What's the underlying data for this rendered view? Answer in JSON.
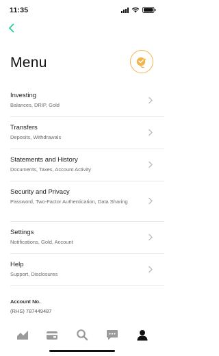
{
  "status_bar": {
    "time": "11:35"
  },
  "header": {
    "title": "Menu"
  },
  "menu": [
    {
      "label": "Investing",
      "sub": "Balances, DRIP, Gold"
    },
    {
      "label": "Transfers",
      "sub": "Deposits, Withdrawals"
    },
    {
      "label": "Statements and History",
      "sub": "Documents, Taxes, Account Activity"
    },
    {
      "label": "Security and Privacy",
      "sub": "Password, Two-Factor Authentication, Data Sharing"
    },
    {
      "label": "Settings",
      "sub": "Notifications, Gold, Account"
    },
    {
      "label": "Help",
      "sub": "Support, Disclosures"
    }
  ],
  "account": {
    "label": "Account No.",
    "number": "(RHS) 787449487"
  },
  "tabs": [
    {
      "icon": "chart-icon",
      "active": false
    },
    {
      "icon": "wallet-icon",
      "active": false
    },
    {
      "icon": "search-icon",
      "active": false
    },
    {
      "icon": "chat-icon",
      "active": false
    },
    {
      "icon": "person-icon",
      "active": true
    }
  ],
  "colors": {
    "accent": "#21ce99",
    "avatar_ring": "#f2b54d",
    "tab_inactive": "#9a9a9a",
    "tab_active": "#111111"
  }
}
